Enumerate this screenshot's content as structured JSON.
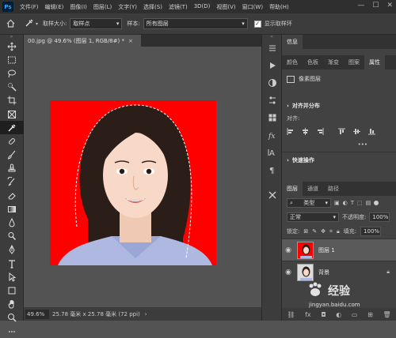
{
  "app": {
    "logo": "Ps"
  },
  "menubar": {
    "items": [
      "文件(F)",
      "编辑(E)",
      "图像(I)",
      "图层(L)",
      "文字(Y)",
      "选择(S)",
      "滤镜(T)",
      "3D(D)",
      "视图(V)",
      "窗口(W)",
      "帮助(H)"
    ],
    "window_buttons": [
      "—",
      "☐",
      "✕"
    ]
  },
  "options": {
    "sample_size_label": "取样大小:",
    "sample_size_value": "取样点",
    "sample_label": "样本:",
    "sample_value": "所有图层",
    "show_ring_label": "显示取样环",
    "show_ring_checked": true
  },
  "document": {
    "tab_title": "00.jpg @ 49.6% (图层 1, RGB/8#) *",
    "tab_close": "×"
  },
  "status": {
    "zoom": "49.6%",
    "size": "25.78 毫米 x 25.78 毫米 (72 ppi)",
    "arrow": "›"
  },
  "panels": {
    "top_tabs": [
      "信息"
    ],
    "prop_tabs": [
      "颜色",
      "色板",
      "渐变",
      "图案",
      "属性"
    ],
    "pixel_layer_label": "像素图层",
    "align_title": "对齐并分布",
    "align_label": "对齐:",
    "quick_title": "快速操作",
    "more": "•••",
    "layer_tabs": [
      "图层",
      "通道",
      "路径"
    ],
    "filter_kind": "类型",
    "blend_mode": "正常",
    "opacity_label": "不透明度:",
    "opacity_value": "100%",
    "lock_label": "锁定:",
    "fill_label": "填充:",
    "fill_value": "100%",
    "layers": [
      {
        "name": "图层 1",
        "selected": true
      },
      {
        "name": "背景",
        "selected": false
      }
    ]
  },
  "watermark": {
    "text": "经验",
    "sub": "jingyan.baidu.com"
  },
  "colors": {
    "canvas_bg": "#ff0000",
    "panel": "#424242",
    "accent_selected": "#5a5a5a"
  }
}
